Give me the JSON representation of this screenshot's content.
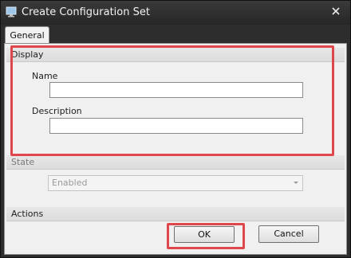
{
  "window": {
    "title": "Create Configuration Set"
  },
  "tabs": [
    {
      "label": "General"
    }
  ],
  "display_group": {
    "header": "Display",
    "name_label": "Name",
    "name_value": "",
    "description_label": "Description",
    "description_value": ""
  },
  "state_group": {
    "header": "State",
    "selected": "Enabled"
  },
  "actions_group": {
    "header": "Actions",
    "ok_label": "OK",
    "cancel_label": "Cancel"
  },
  "colors": {
    "highlight": "#e0474c",
    "titlebar": "#2d2d2d",
    "panel": "#f0f0f0"
  }
}
